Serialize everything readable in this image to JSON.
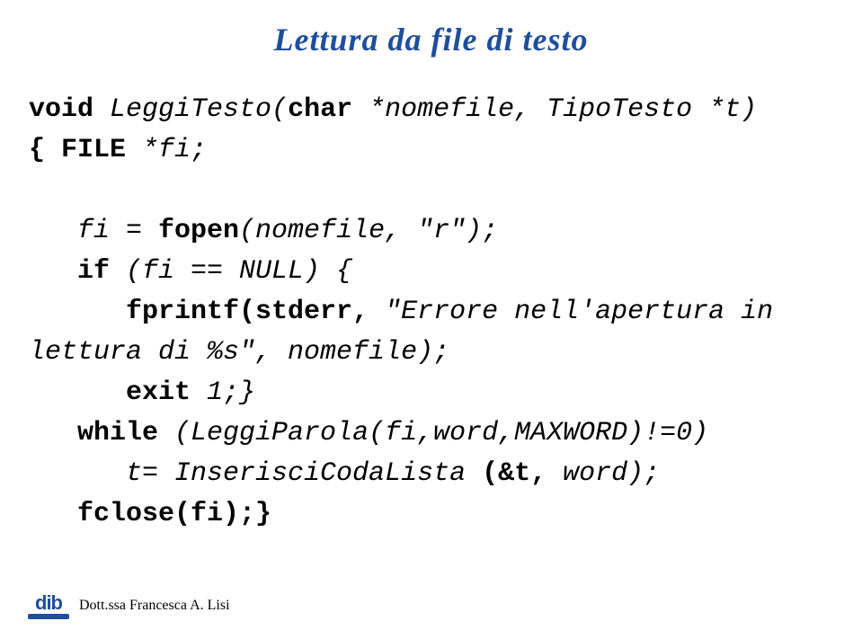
{
  "title": "Lettura da file di testo",
  "code": {
    "l1_kw1": "void",
    "l1_it1": " LeggiTesto(",
    "l1_kw2": "char",
    "l1_it2": " *nomefile, TipoTesto *t)",
    "l2_kw1": "{ FILE",
    "l2_it1": " *fi;",
    "l3": "",
    "l4_it1": "   fi = ",
    "l4_kw1": "fopen",
    "l4_it2": "(nomefile, \"r\");",
    "l5_kw1": "   if",
    "l5_it1": " (fi == NULL) {",
    "l6_kw1": "      fprintf(stderr,",
    "l6_it1": " \"Errore nell'apertura in ",
    "l7_it1": "lettura di %s\", nomefile);",
    "l8_kw1": "      exit",
    "l8_it1": " 1;}",
    "l9_kw1": "   while",
    "l9_it1": " (LeggiParola(fi,word,MAXWORD)!=0)",
    "l10_it1": "      t= InserisciCodaLista ",
    "l10_kw1": "(&t,",
    "l10_it2": " word);",
    "l11_kw1": "   fclose(fi);}"
  },
  "footer": {
    "logo_text": "dib",
    "author": "Dott.ssa Francesca A. Lisi"
  }
}
